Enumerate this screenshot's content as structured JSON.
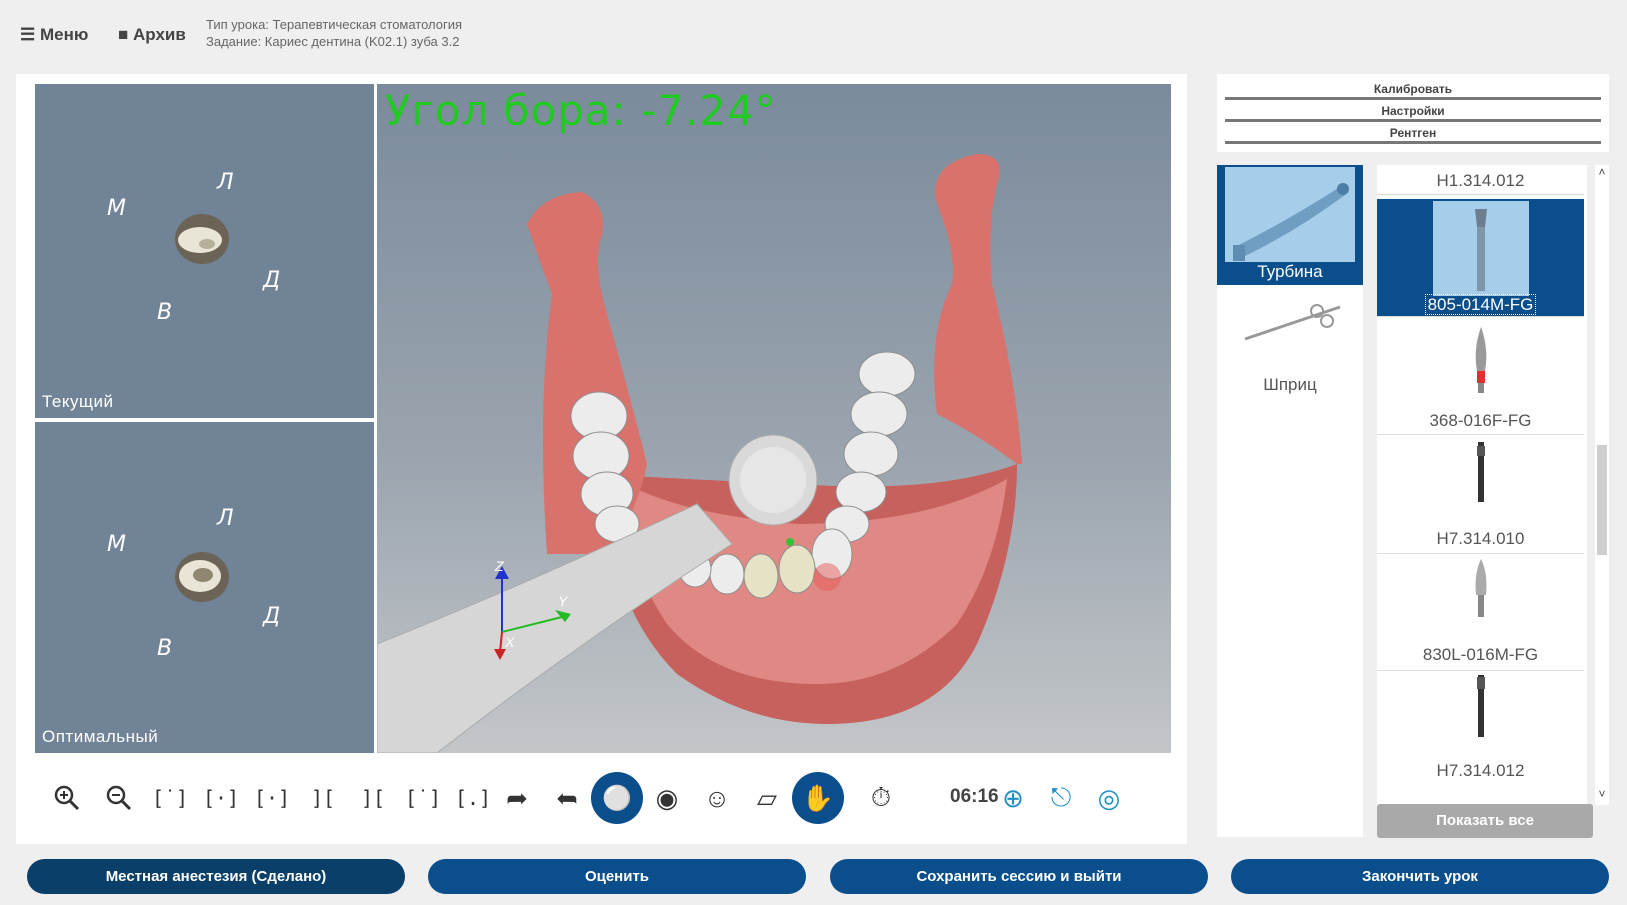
{
  "topbar": {
    "menu_label": "Меню",
    "archive_label": "Архив",
    "lesson_type": "Тип урока: Терапевтическая стоматология",
    "task": "Задание: Кариес дентина (K02.1) зуба 3.2"
  },
  "previews": {
    "current_label": "Текущий",
    "optimal_label": "Оптимальный",
    "dir_m": "М",
    "dir_l": "Л",
    "dir_d": "Д",
    "dir_v": "В"
  },
  "viewport": {
    "angle_text": "Угол бора: -7.24°",
    "axis_x": "X",
    "axis_y": "Y",
    "axis_z": "Z"
  },
  "toolbar": {
    "timer": "06:16",
    "view_glyphs": [
      "[·]",
      "[·]",
      "[·]",
      "[·]",
      "[·]",
      "[·]",
      "[·]"
    ]
  },
  "right_menu": {
    "calibrate": "Калибровать",
    "settings": "Настройки",
    "xray": "Рентген"
  },
  "tools": [
    {
      "name": "Турбина",
      "selected": true
    },
    {
      "name": "Шприц",
      "selected": false
    }
  ],
  "burs": [
    {
      "code": "H1.314.012"
    },
    {
      "code": "805-014M-FG",
      "selected": true
    },
    {
      "code": "368-016F-FG"
    },
    {
      "code": "H7.314.010"
    },
    {
      "code": "830L-016M-FG"
    },
    {
      "code": "H7.314.012"
    }
  ],
  "show_all_label": "Показать все",
  "bottom": {
    "anesthesia": "Местная анестезия (Сделано)",
    "evaluate": "Оценить",
    "save_exit": "Сохранить сессию и выйти",
    "finish": "Закончить урок"
  },
  "colors": {
    "accent": "#0a4f8c",
    "angle_text": "#1fcb1f",
    "preview_bg": "#718396",
    "gum": "#d06f6c"
  }
}
